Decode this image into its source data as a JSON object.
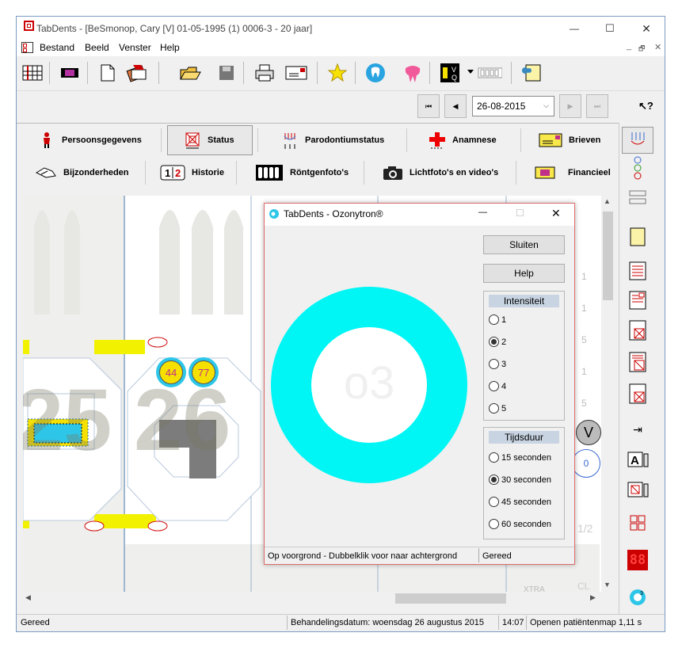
{
  "window": {
    "title": "TabDents - [BeSmonop, Cary [V] 01-05-1995 (1) 0006-3 - 20 jaar]",
    "minimize": "—",
    "maximize": "☐",
    "close": "✕"
  },
  "menu": {
    "items": [
      "Bestand",
      "Beeld",
      "Venster",
      "Help"
    ],
    "mdi_controls": [
      "_",
      "🗗",
      "✕"
    ]
  },
  "nav": {
    "date": "26-08-2015",
    "first": "⏮",
    "prev": "◀",
    "next": "▶",
    "last": "⏭",
    "help_cursor": "↖?"
  },
  "tabs": {
    "row1": [
      {
        "label": "Persoonsgegevens",
        "icon": "person-icon"
      },
      {
        "label": "Status",
        "icon": "tooth-status-icon"
      },
      {
        "label": "Parodontiumstatus",
        "icon": "perio-icon"
      },
      {
        "label": "Anamnese",
        "icon": "red-cross-icon"
      },
      {
        "label": "Brieven",
        "icon": "letter-icon"
      }
    ],
    "row2": [
      {
        "label": "Bijzonderheden",
        "icon": "hand-icon"
      },
      {
        "label": "Historie",
        "icon": "history-icon"
      },
      {
        "label": "Röntgenfoto's",
        "icon": "xray-icon"
      },
      {
        "label": "Lichtfoto's en video's",
        "icon": "camera-icon"
      },
      {
        "label": "Financieel",
        "icon": "money-icon"
      }
    ]
  },
  "chart": {
    "tooth_numbers": [
      "25",
      "26"
    ],
    "badges": [
      "44",
      "77"
    ],
    "right_values": [
      "1",
      "1",
      "5",
      "1",
      "5",
      "0",
      "1/2"
    ],
    "xtra": "XTRA",
    "cl": "CL"
  },
  "dialog": {
    "title": "TabDents - Ozonytron®",
    "minimize": "—",
    "maximize": "☐",
    "close": "✕",
    "ring_label": "O3",
    "close_button": "Sluiten",
    "help_button": "Help",
    "intensity": {
      "title": "Intensiteit",
      "options": [
        "1",
        "2",
        "3",
        "4",
        "5"
      ],
      "selected": "2"
    },
    "duration": {
      "title": "Tijdsduur",
      "options": [
        "15 seconden",
        "30 seconden",
        "45 seconden",
        "60 seconden"
      ],
      "selected": "30 seconden"
    },
    "status_left": "Op voorgrond - Dubbelklik voor naar achtergrond",
    "status_right": "Gereed",
    "ring_color": "#00f5f5"
  },
  "statusbar": {
    "left": "Gereed",
    "treatment_date": "Behandelingsdatum: woensdag 26 augustus 2015",
    "time": "14:07",
    "message": "Openen patiëntenmap 1,11 s"
  },
  "right_toolbar": {
    "counter": "88"
  },
  "colors": {
    "accent_red": "#d01010",
    "badge_yellow": "#f5e000",
    "badge_ring": "#2dc6e8",
    "highlight_yellow": "#f2f200"
  }
}
